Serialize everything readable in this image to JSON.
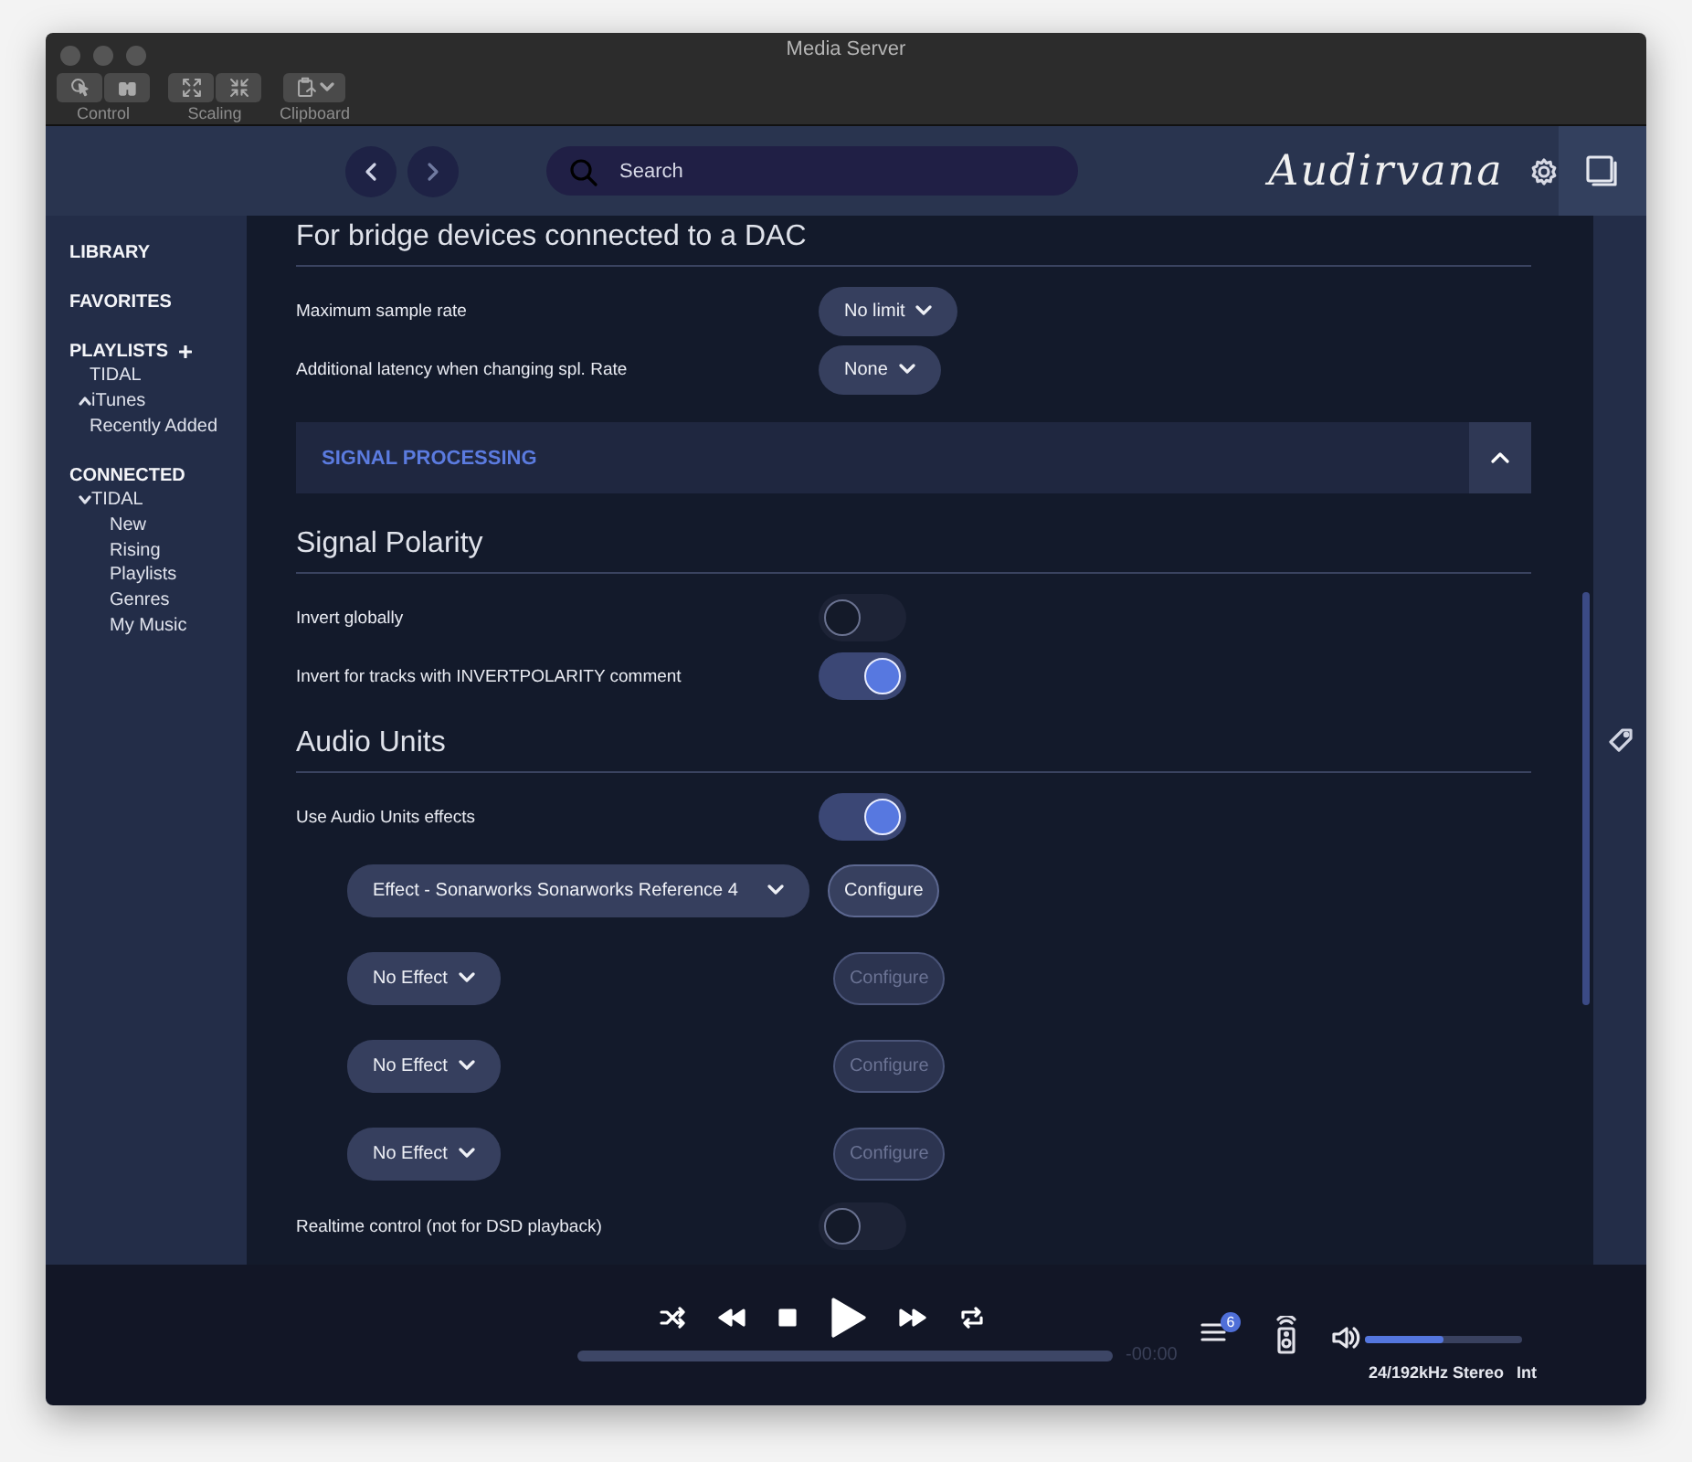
{
  "window": {
    "title": "Media Server"
  },
  "toolbar": [
    {
      "label": "Control",
      "buttons": [
        {
          "kind": "cursor"
        },
        {
          "kind": "binoculars"
        }
      ]
    },
    {
      "label": "Scaling",
      "buttons": [
        {
          "kind": "expand"
        },
        {
          "kind": "shrink"
        }
      ]
    },
    {
      "label": "Clipboard",
      "buttons": [
        {
          "kind": "clipboard"
        }
      ]
    }
  ],
  "header": {
    "search": {
      "placeholder": "Search"
    },
    "logo": "Audirvana"
  },
  "sidebar": [
    {
      "label": "LIBRARY"
    },
    {
      "label": "FAVORITES"
    },
    {
      "label": "PLAYLISTS",
      "addable": true,
      "children": [
        {
          "label": "TIDAL"
        },
        {
          "label": "iTunes",
          "expanded": false
        },
        {
          "label": "Recently Added"
        }
      ]
    },
    {
      "label": "CONNECTED",
      "children": [
        {
          "label": "TIDAL",
          "expanded": true,
          "children": [
            {
              "label": "New"
            },
            {
              "label": "Rising"
            },
            {
              "label": "Playlists"
            },
            {
              "label": "Genres"
            },
            {
              "label": "My Music"
            }
          ]
        }
      ]
    }
  ],
  "settings": [
    {
      "kind": "heading",
      "label": "For bridge devices connected to a DAC"
    },
    {
      "kind": "dropdown",
      "label": "Maximum sample rate",
      "value": "No limit"
    },
    {
      "kind": "dropdown",
      "label": "Additional latency when changing spl. Rate",
      "value": "None"
    },
    {
      "kind": "banner",
      "label": "SIGNAL PROCESSING",
      "expanded": true
    },
    {
      "kind": "heading",
      "label": "Signal Polarity"
    },
    {
      "kind": "toggle",
      "label": "Invert globally",
      "on": false
    },
    {
      "kind": "toggle",
      "label": "Invert for tracks with INVERTPOLARITY comment",
      "on": true
    },
    {
      "kind": "heading",
      "label": "Audio Units"
    },
    {
      "kind": "toggle",
      "label": "Use Audio Units effects",
      "on": true
    },
    {
      "kind": "effect",
      "value": "Effect - Sonarworks Sonarworks Reference 4",
      "button": "Configure",
      "disabled": false
    },
    {
      "kind": "effect",
      "value": "No Effect",
      "button": "Configure",
      "disabled": true
    },
    {
      "kind": "effect",
      "value": "No Effect",
      "button": "Configure",
      "disabled": true
    },
    {
      "kind": "effect",
      "value": "No Effect",
      "button": "Configure",
      "disabled": true
    },
    {
      "kind": "toggle",
      "label": "Realtime control (not for DSD playback)",
      "on": false
    }
  ],
  "player": {
    "progress": {
      "level": 0
    },
    "time": "-00:00",
    "queue_count": "6",
    "volume": {
      "level": 0.5
    },
    "format": "24/192kHz Stereo",
    "output": "Int"
  }
}
